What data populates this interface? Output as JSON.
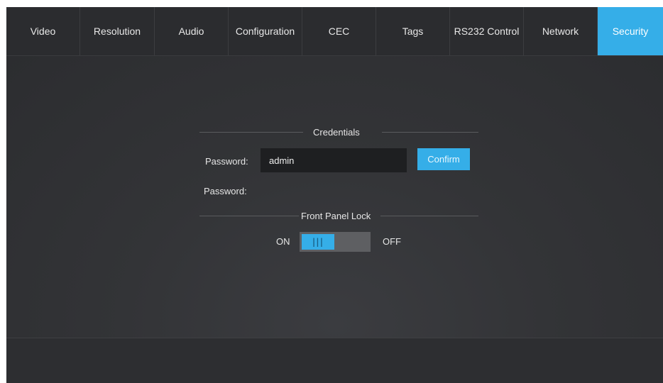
{
  "tabs": [
    {
      "label": "Video",
      "active": false
    },
    {
      "label": "Resolution",
      "active": false
    },
    {
      "label": "Audio",
      "active": false
    },
    {
      "label": "Configuration",
      "active": false
    },
    {
      "label": "CEC",
      "active": false
    },
    {
      "label": "Tags",
      "active": false
    },
    {
      "label": "RS232 Control",
      "active": false
    },
    {
      "label": "Network",
      "active": false
    },
    {
      "label": "Security",
      "active": true
    }
  ],
  "credentials": {
    "title": "Credentials",
    "password_label": "Password:",
    "password_value": "admin",
    "confirm_label": "Confirm",
    "password_label_2": "Password:"
  },
  "front_panel_lock": {
    "title": "Front Panel Lock",
    "on_label": "ON",
    "off_label": "OFF",
    "state": "ON",
    "knob_glyph": "|||"
  },
  "colors": {
    "accent": "#35aee8",
    "background": "#2f3033",
    "input_background": "#1e1f21"
  }
}
